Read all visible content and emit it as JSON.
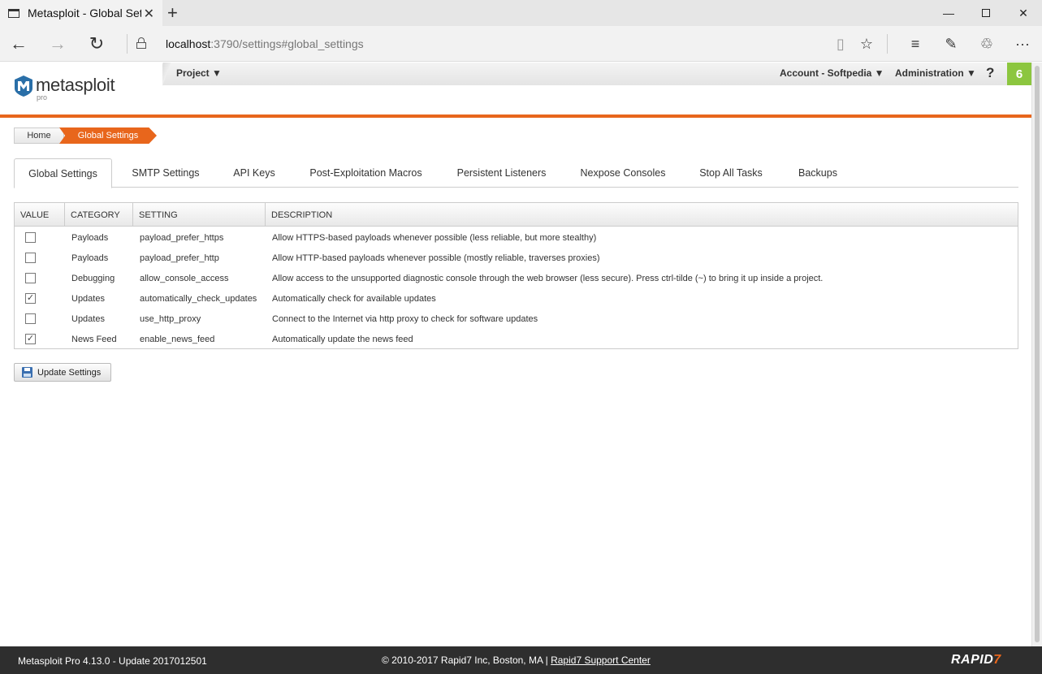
{
  "browser": {
    "tab_title": "Metasploit - Global Sett",
    "address_host": "localhost",
    "address_rest": ":3790/settings#global_settings",
    "tab_close": "✕",
    "new_tab": "+",
    "icons": [
      "back-icon",
      "forward-icon",
      "refresh-icon",
      "lock-icon",
      "reading-view-icon",
      "favorite-icon",
      "hub-icon",
      "web-note-icon",
      "share-icon",
      "more-icon"
    ]
  },
  "header": {
    "logo": "metasploit",
    "logo_sub": "pro",
    "project": "Project ▼",
    "account": "Account - Softpedia ▼",
    "administration": "Administration ▼",
    "help": "?",
    "notifications": "6",
    "accent_color": "#e8661c",
    "badge_color": "#8cc63f"
  },
  "breadcrumb": {
    "home": "Home",
    "current": "Global Settings"
  },
  "tabs": [
    {
      "label": "Global Settings",
      "active": true
    },
    {
      "label": "SMTP Settings",
      "active": false
    },
    {
      "label": "API Keys",
      "active": false
    },
    {
      "label": "Post-Exploitation Macros",
      "active": false
    },
    {
      "label": "Persistent Listeners",
      "active": false
    },
    {
      "label": "Nexpose Consoles",
      "active": false
    },
    {
      "label": "Stop All Tasks",
      "active": false
    },
    {
      "label": "Backups",
      "active": false
    }
  ],
  "table": {
    "columns": [
      "VALUE",
      "CATEGORY",
      "SETTING",
      "DESCRIPTION"
    ],
    "rows": [
      {
        "checked": false,
        "category": "Payloads",
        "setting": "payload_prefer_https",
        "description": "Allow HTTPS-based payloads whenever possible (less reliable, but more stealthy)"
      },
      {
        "checked": false,
        "category": "Payloads",
        "setting": "payload_prefer_http",
        "description": "Allow HTTP-based payloads whenever possible (mostly reliable, traverses proxies)"
      },
      {
        "checked": false,
        "category": "Debugging",
        "setting": "allow_console_access",
        "description": "Allow access to the unsupported diagnostic console through the web browser (less secure). Press ctrl-tilde (~) to bring it up inside a project."
      },
      {
        "checked": true,
        "category": "Updates",
        "setting": "automatically_check_updates",
        "description": "Automatically check for available updates"
      },
      {
        "checked": false,
        "category": "Updates",
        "setting": "use_http_proxy",
        "description": "Connect to the Internet via http proxy to check for software updates"
      },
      {
        "checked": true,
        "category": "News Feed",
        "setting": "enable_news_feed",
        "description": "Automatically update the news feed"
      }
    ]
  },
  "update_button": "Update Settings",
  "footer": {
    "version": "Metasploit Pro 4.13.0 - Update 2017012501",
    "copyright": "© 2010-2017 Rapid7 Inc, Boston, MA | ",
    "support_link": "Rapid7 Support Center",
    "logo_main": "RAPID",
    "logo_accent": "7"
  }
}
